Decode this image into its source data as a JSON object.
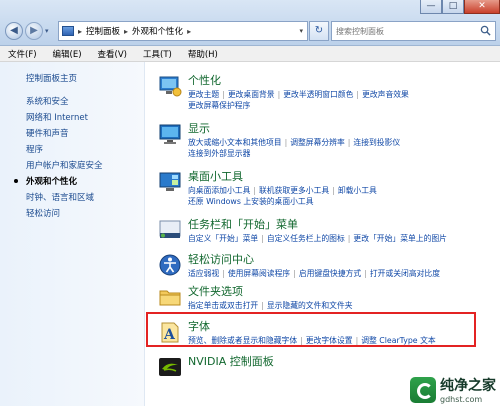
{
  "window": {
    "controls": {
      "minimize": "—",
      "maximize": "□",
      "close": "✕"
    }
  },
  "nav": {
    "back": "◀",
    "forward": "▶",
    "dropdown": "▾"
  },
  "address": {
    "segments": [
      "控制面板",
      "外观和个性化"
    ],
    "separator": "▸",
    "dropdown": "▾"
  },
  "refresh_symbol": "↻",
  "search": {
    "placeholder": "搜索控制面板"
  },
  "menubar": {
    "items": [
      "文件(F)",
      "编辑(E)",
      "查看(V)",
      "工具(T)",
      "帮助(H)"
    ]
  },
  "sidebar": {
    "home": "控制面板主页",
    "items": [
      "系统和安全",
      "网络和 Internet",
      "硬件和声音",
      "程序",
      "用户帐户和家庭安全",
      "外观和个性化",
      "时钟、语言和区域",
      "轻松访问"
    ],
    "current_index": 5
  },
  "categories": [
    {
      "title": "个性化",
      "icon": "personalization-icon",
      "links": [
        [
          "更改主题",
          "更改桌面背景",
          "更改半透明窗口颜色",
          "更改声音效果"
        ],
        [
          "更改屏幕保护程序"
        ]
      ]
    },
    {
      "title": "显示",
      "icon": "display-icon",
      "links": [
        [
          "放大或缩小文本和其他项目",
          "调整屏幕分辨率",
          "连接到投影仪"
        ],
        [
          "连接到外部显示器"
        ]
      ]
    },
    {
      "title": "桌面小工具",
      "icon": "gadgets-icon",
      "links": [
        [
          "向桌面添加小工具",
          "联机获取更多小工具",
          "卸载小工具"
        ],
        [
          "还原 Windows 上安装的桌面小工具"
        ]
      ]
    },
    {
      "title": "任务栏和「开始」菜单",
      "icon": "taskbar-icon",
      "links": [
        [
          "自定义「开始」菜单",
          "自定义任务栏上的图标",
          "更改「开始」菜单上的图片"
        ]
      ]
    },
    {
      "title": "轻松访问中心",
      "icon": "ease-of-access-icon",
      "links": [
        [
          "适应弱视",
          "使用屏幕阅读程序",
          "启用键盘快捷方式",
          "打开或关闭高对比度"
        ]
      ]
    },
    {
      "title": "文件夹选项",
      "icon": "folder-options-icon",
      "links": [
        [
          "指定单击或双击打开",
          "显示隐藏的文件和文件夹"
        ]
      ]
    },
    {
      "title": "字体",
      "icon": "fonts-icon",
      "links": [
        [
          "预览、删除或者显示和隐藏字体",
          "更改字体设置",
          "调整 ClearType 文本"
        ]
      ]
    },
    {
      "title": "NVIDIA 控制面板",
      "icon": "nvidia-icon",
      "links": []
    }
  ],
  "watermark": {
    "title": "纯净之家",
    "subtitle": "gdhst.com"
  },
  "colors": {
    "highlight_border": "#e32323",
    "category_title": "#11672e",
    "link": "#0f47a6"
  }
}
